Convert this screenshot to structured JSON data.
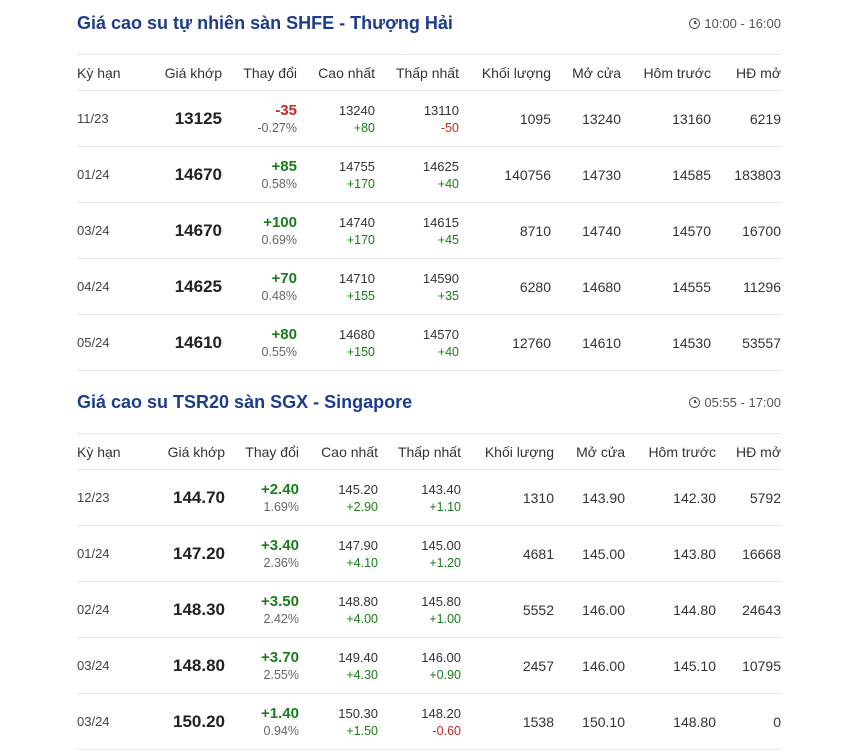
{
  "colors": {
    "title": "#1e3c8c",
    "up": "#1a7d1a",
    "down": "#c62828"
  },
  "sections": [
    {
      "title": "Giá cao su tự nhiên sàn SHFE - Thượng Hải",
      "time": "10:00 - 16:00",
      "headers": [
        "Kỳ hạn",
        "Giá khớp",
        "Thay đổi",
        "Cao nhất",
        "Thấp nhất",
        "Khối lượng",
        "Mở cửa",
        "Hôm trước",
        "HĐ mở"
      ],
      "rows": [
        {
          "term": "11/23",
          "price": "13125",
          "change": "-35",
          "change_pct": "-0.27%",
          "high": "13240",
          "high_diff": "+80",
          "low": "13110",
          "low_diff": "-50",
          "volume": "1095",
          "open": "13240",
          "prev": "13160",
          "oi": "6219"
        },
        {
          "term": "01/24",
          "price": "14670",
          "change": "+85",
          "change_pct": "0.58%",
          "high": "14755",
          "high_diff": "+170",
          "low": "14625",
          "low_diff": "+40",
          "volume": "140756",
          "open": "14730",
          "prev": "14585",
          "oi": "183803"
        },
        {
          "term": "03/24",
          "price": "14670",
          "change": "+100",
          "change_pct": "0.69%",
          "high": "14740",
          "high_diff": "+170",
          "low": "14615",
          "low_diff": "+45",
          "volume": "8710",
          "open": "14740",
          "prev": "14570",
          "oi": "16700"
        },
        {
          "term": "04/24",
          "price": "14625",
          "change": "+70",
          "change_pct": "0.48%",
          "high": "14710",
          "high_diff": "+155",
          "low": "14590",
          "low_diff": "+35",
          "volume": "6280",
          "open": "14680",
          "prev": "14555",
          "oi": "11296"
        },
        {
          "term": "05/24",
          "price": "14610",
          "change": "+80",
          "change_pct": "0.55%",
          "high": "14680",
          "high_diff": "+150",
          "low": "14570",
          "low_diff": "+40",
          "volume": "12760",
          "open": "14610",
          "prev": "14530",
          "oi": "53557"
        }
      ]
    },
    {
      "title": "Giá cao su TSR20 sàn SGX - Singapore",
      "time": "05:55 - 17:00",
      "headers": [
        "Kỳ hạn",
        "Giá khớp",
        "Thay đổi",
        "Cao nhất",
        "Thấp nhất",
        "Khối lượng",
        "Mở cửa",
        "Hôm trước",
        "HĐ mở"
      ],
      "rows": [
        {
          "term": "12/23",
          "price": "144.70",
          "change": "+2.40",
          "change_pct": "1.69%",
          "high": "145.20",
          "high_diff": "+2.90",
          "low": "143.40",
          "low_diff": "+1.10",
          "volume": "1310",
          "open": "143.90",
          "prev": "142.30",
          "oi": "5792"
        },
        {
          "term": "01/24",
          "price": "147.20",
          "change": "+3.40",
          "change_pct": "2.36%",
          "high": "147.90",
          "high_diff": "+4.10",
          "low": "145.00",
          "low_diff": "+1.20",
          "volume": "4681",
          "open": "145.00",
          "prev": "143.80",
          "oi": "16668"
        },
        {
          "term": "02/24",
          "price": "148.30",
          "change": "+3.50",
          "change_pct": "2.42%",
          "high": "148.80",
          "high_diff": "+4.00",
          "low": "145.80",
          "low_diff": "+1.00",
          "volume": "5552",
          "open": "146.00",
          "prev": "144.80",
          "oi": "24643"
        },
        {
          "term": "03/24",
          "price": "148.80",
          "change": "+3.70",
          "change_pct": "2.55%",
          "high": "149.40",
          "high_diff": "+4.30",
          "low": "146.00",
          "low_diff": "+0.90",
          "volume": "2457",
          "open": "146.00",
          "prev": "145.10",
          "oi": "10795"
        },
        {
          "term": "03/24",
          "price": "150.20",
          "change": "+1.40",
          "change_pct": "0.94%",
          "high": "150.30",
          "high_diff": "+1.50",
          "low": "148.20",
          "low_diff": "-0.60",
          "volume": "1538",
          "open": "150.10",
          "prev": "148.80",
          "oi": "0"
        }
      ]
    }
  ]
}
